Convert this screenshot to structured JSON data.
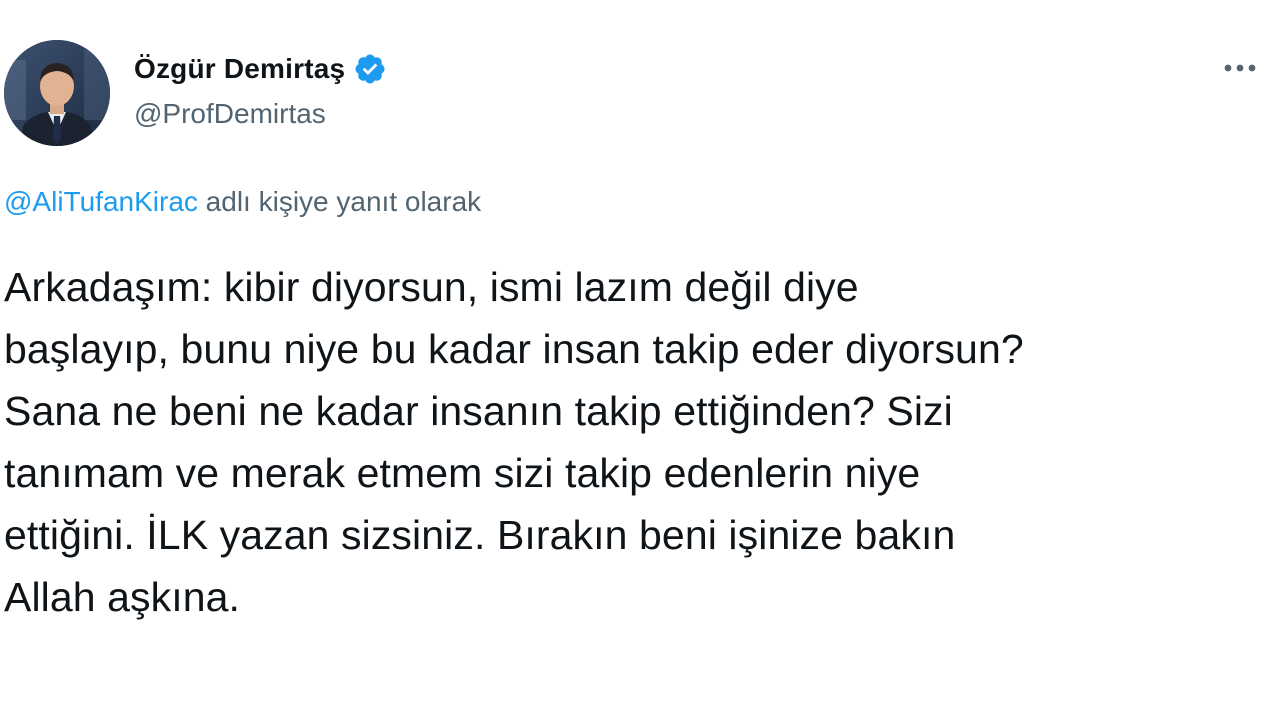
{
  "author": {
    "display_name": "Özgür Demirtaş",
    "handle": "@ProfDemirtas",
    "verified": true,
    "avatar": "profile-photo"
  },
  "menu": {
    "icon": "more-horizontal-icon"
  },
  "reply_context": {
    "mention": "@AliTufanKirac",
    "suffix": " adlı kişiye yanıt olarak"
  },
  "tweet": {
    "lines": [
      "Arkadaşım: kibir diyorsun, ismi lazım değil diye",
      "başlayıp, bunu niye bu kadar insan takip eder diyorsun?",
      "Sana ne beni ne kadar insanın takip ettiğinden? Sizi",
      "tanımam ve merak etmem sizi takip edenlerin niye",
      "ettiğini. İLK yazan sizsiniz. Bırakın beni işinize bakın",
      "Allah aşkına."
    ]
  },
  "colors": {
    "text": "#0f1419",
    "secondary": "#536471",
    "accent": "#1d9bf0"
  }
}
